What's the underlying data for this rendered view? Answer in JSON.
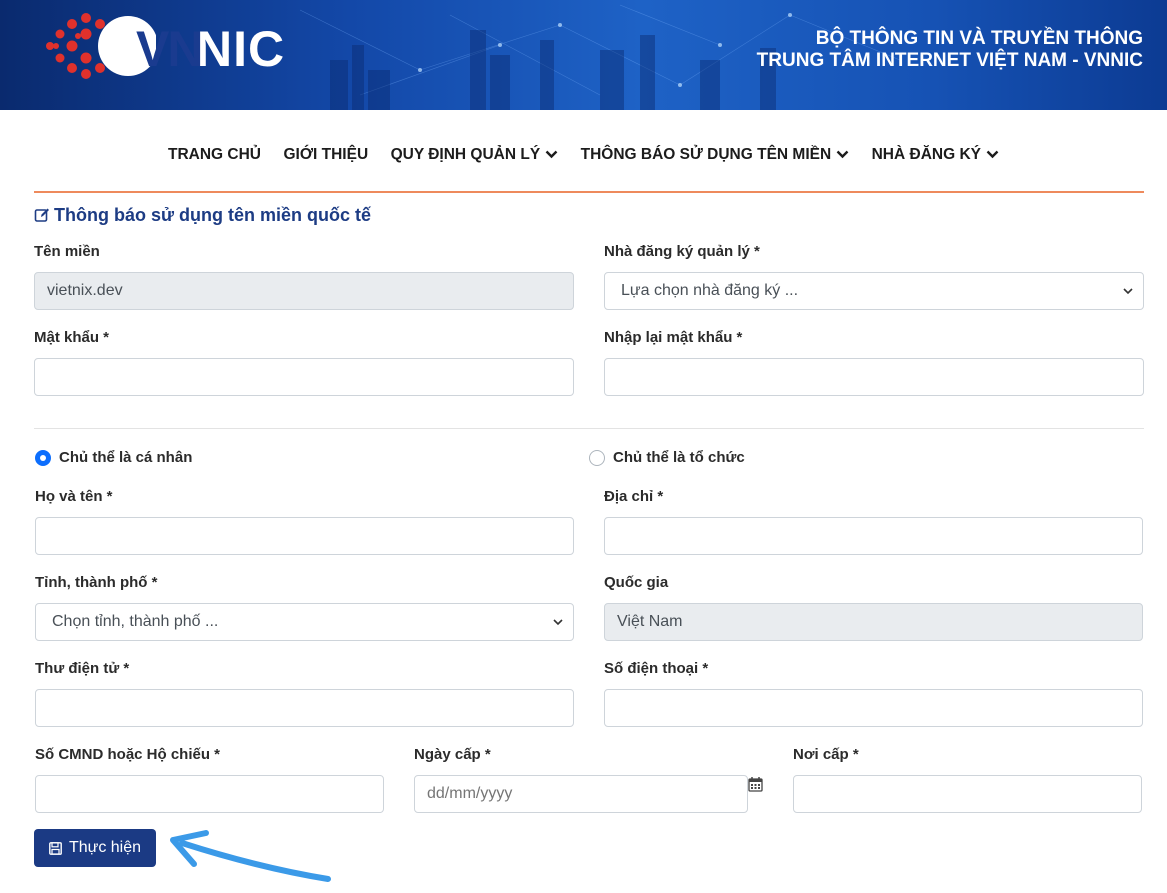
{
  "header": {
    "logo_text": "VNNIC",
    "org_line1": "BỘ THÔNG TIN VÀ TRUYỀN THÔNG",
    "org_line2": "TRUNG TÂM INTERNET VIỆT NAM - VNNIC"
  },
  "nav": {
    "items": [
      {
        "label": "TRANG CHỦ",
        "dropdown": false
      },
      {
        "label": "GIỚI THIỆU",
        "dropdown": false
      },
      {
        "label": "QUY ĐỊNH QUẢN LÝ",
        "dropdown": true
      },
      {
        "label": "THÔNG BÁO SỬ DỤNG TÊN MIỀN",
        "dropdown": true
      },
      {
        "label": "NHÀ ĐĂNG KÝ",
        "dropdown": true
      }
    ]
  },
  "form": {
    "title": "Thông báo sử dụng tên miền quốc tế",
    "domain": {
      "label": "Tên miền",
      "value": "vietnix.dev"
    },
    "registrar": {
      "label": "Nhà đăng ký quản lý *",
      "selected": "Lựa chọn nhà đăng ký ..."
    },
    "password": {
      "label": "Mật khẩu *",
      "value": ""
    },
    "password_confirm": {
      "label": "Nhập lại mật khẩu *",
      "value": ""
    },
    "subject_type": {
      "individual": {
        "label": "Chủ thể là cá nhân",
        "checked": true
      },
      "organization": {
        "label": "Chủ thể là tổ chức",
        "checked": false
      }
    },
    "full_name": {
      "label": "Họ và tên *",
      "value": ""
    },
    "address": {
      "label": "Địa chỉ *",
      "value": ""
    },
    "province": {
      "label": "Tỉnh, thành phố *",
      "selected": "Chọn tỉnh, thành phố ..."
    },
    "country": {
      "label": "Quốc gia",
      "value": "Việt Nam"
    },
    "email": {
      "label": "Thư điện tử *",
      "value": ""
    },
    "phone": {
      "label": "Số điện thoại *",
      "value": ""
    },
    "id_number": {
      "label": "Số CMND hoặc Hộ chiếu *",
      "value": ""
    },
    "issue_date": {
      "label": "Ngày cấp *",
      "placeholder": "dd/mm/yyyy"
    },
    "issue_place": {
      "label": "Nơi cấp *",
      "value": ""
    },
    "submit_label": "Thực hiện"
  },
  "colors": {
    "primary": "#1b3a84",
    "heading": "#1d3c84",
    "accent_rule": "#ee8a5c",
    "radio_active": "#0d6efd",
    "annotation_arrow": "#3b9ae8"
  }
}
